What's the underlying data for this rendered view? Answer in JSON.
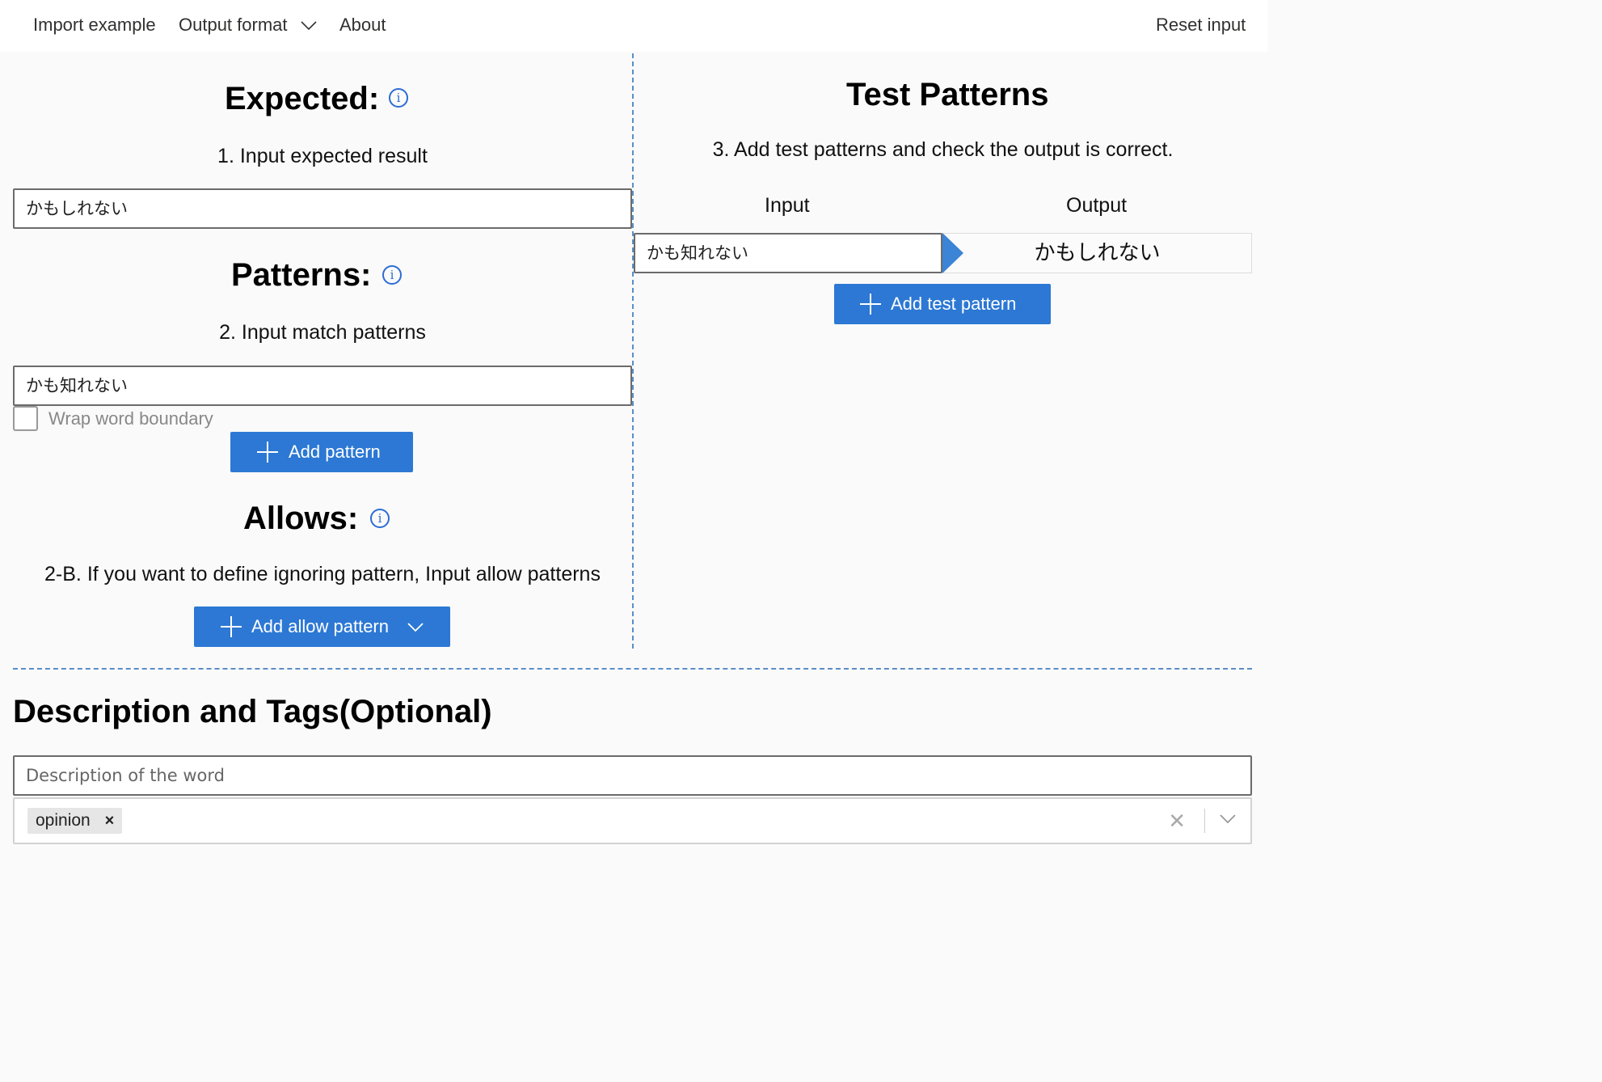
{
  "topbar": {
    "import_example": "Import example",
    "output_format": "Output format",
    "about": "About",
    "reset_input": "Reset input"
  },
  "expected": {
    "heading": "Expected:",
    "instruction": "1. Input expected result",
    "value": "かもしれない"
  },
  "patterns": {
    "heading": "Patterns:",
    "instruction": "2. Input match patterns",
    "value": "かも知れない",
    "wrap_label": "Wrap word boundary",
    "wrap_checked": false,
    "add_button": "Add pattern"
  },
  "allows": {
    "heading": "Allows:",
    "instruction": "2-B. If you want to define ignoring pattern, Input allow patterns",
    "add_button": "Add allow pattern"
  },
  "test_patterns": {
    "heading": "Test Patterns",
    "instruction": "3. Add test patterns and check the output is correct.",
    "input_header": "Input",
    "output_header": "Output",
    "rows": [
      {
        "input": "かも知れない",
        "output": "かもしれない"
      }
    ],
    "add_button": "Add test pattern"
  },
  "description": {
    "heading": "Description and Tags(Optional)",
    "placeholder": "Description of the word",
    "tags": [
      "opinion"
    ]
  },
  "icons": {
    "info": "info-icon",
    "chevron": "chevron-down-icon",
    "plus": "plus-icon",
    "clear": "close-icon"
  },
  "colors": {
    "accent": "#2c78d4",
    "divider": "#5b8ec7"
  }
}
